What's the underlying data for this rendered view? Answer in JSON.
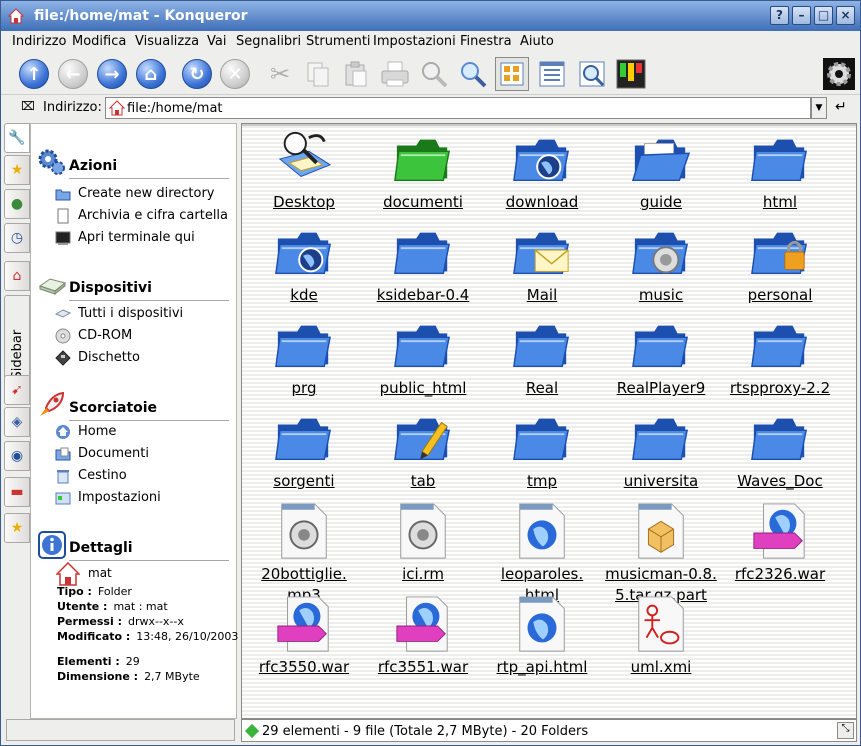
{
  "window": {
    "title": "file:/home/mat - Konqueror",
    "buttons": [
      "?",
      "–",
      "□",
      "×"
    ]
  },
  "menu": [
    "Indirizzo",
    "Modifica",
    "Visualizza",
    "Vai",
    "Segnalibri",
    "Strumenti",
    "Impostazioni",
    "Finestra",
    "Aiuto"
  ],
  "toolbar": [
    "up-icon",
    "back-icon",
    "forward-icon",
    "home-icon",
    "reload-icon",
    "stop-icon",
    "cut-icon",
    "copy-icon",
    "paste-icon",
    "print-icon",
    "zoom-in-icon",
    "zoom-out-icon",
    "icon-view-icon",
    "detail-view-icon",
    "preview-icon",
    "konsole-icon",
    "settings-gear-icon"
  ],
  "location": {
    "label": "Indirizzo:",
    "value": "file:/home/mat"
  },
  "sidebar_tab_label": "KSidebar",
  "sidebar": {
    "sections": [
      {
        "title": "Azioni",
        "items": [
          "Create new directory",
          "Archivia e cifra cartella",
          "Apri terminale qui"
        ]
      },
      {
        "title": "Dispositivi",
        "items": [
          "Tutti i dispositivi",
          "CD-ROM",
          "Dischetto"
        ]
      },
      {
        "title": "Scorciatoie",
        "items": [
          "Home",
          "Documenti",
          "Cestino",
          "Impostazioni"
        ]
      },
      {
        "title": "Dettagli",
        "items": []
      }
    ],
    "details": {
      "name": "mat",
      "tipo_label": "Tipo :",
      "tipo": "Folder",
      "utente_label": "Utente :",
      "utente": "mat : mat",
      "permessi_label": "Permessi :",
      "permessi": "drwx--x--x",
      "modificato_label": "Modificato :",
      "modificato": "13:48, 26/10/2003",
      "elementi_label": "Elementi :",
      "elementi": "29",
      "dimensione_label": "Dimensione :",
      "dimensione": "2,7 MByte"
    }
  },
  "files": [
    {
      "name": "Desktop",
      "icon": "desktop-folder"
    },
    {
      "name": "documenti",
      "icon": "green-folder"
    },
    {
      "name": "download",
      "icon": "folder-globe"
    },
    {
      "name": "guide",
      "icon": "open-folder"
    },
    {
      "name": "html",
      "icon": "folder"
    },
    {
      "name": "kde",
      "icon": "folder-globe"
    },
    {
      "name": "ksidebar-0.4",
      "icon": "folder"
    },
    {
      "name": "Mail",
      "icon": "mail-folder"
    },
    {
      "name": "music",
      "icon": "folder-sound"
    },
    {
      "name": "personal",
      "icon": "folder-locked"
    },
    {
      "name": "prg",
      "icon": "folder"
    },
    {
      "name": "public_html",
      "icon": "folder"
    },
    {
      "name": "Real",
      "icon": "folder"
    },
    {
      "name": "RealPlayer9",
      "icon": "folder"
    },
    {
      "name": "rtspproxy-2.2",
      "icon": "folder"
    },
    {
      "name": "sorgenti",
      "icon": "folder"
    },
    {
      "name": "tab",
      "icon": "folder-pencil"
    },
    {
      "name": "tmp",
      "icon": "folder"
    },
    {
      "name": "universita",
      "icon": "folder"
    },
    {
      "name": "Waves_Doc",
      "icon": "folder"
    },
    {
      "name": "20bottiglie.\nmp3",
      "icon": "sound-file"
    },
    {
      "name": "ici.rm",
      "icon": "sound-file"
    },
    {
      "name": "leoparoles.\nhtml",
      "icon": "html-file"
    },
    {
      "name": "musicman-0.8.\n5.tar.gz.part",
      "icon": "tgz-file"
    },
    {
      "name": "rfc2326.war",
      "icon": "www-file"
    },
    {
      "name": "rfc3550.war",
      "icon": "www-file"
    },
    {
      "name": "rfc3551.war",
      "icon": "www-file"
    },
    {
      "name": "rtp_api.html",
      "icon": "html-file"
    },
    {
      "name": "uml.xmi",
      "icon": "uml-file"
    }
  ],
  "status": {
    "text": "29 elementi - 9 file (Totale 2,7 MByte) - 20 Folders"
  },
  "colors": {
    "folder": "#3f7fe0",
    "folder_green": "#2ea82e",
    "title_bar": "#4f7fc6"
  }
}
